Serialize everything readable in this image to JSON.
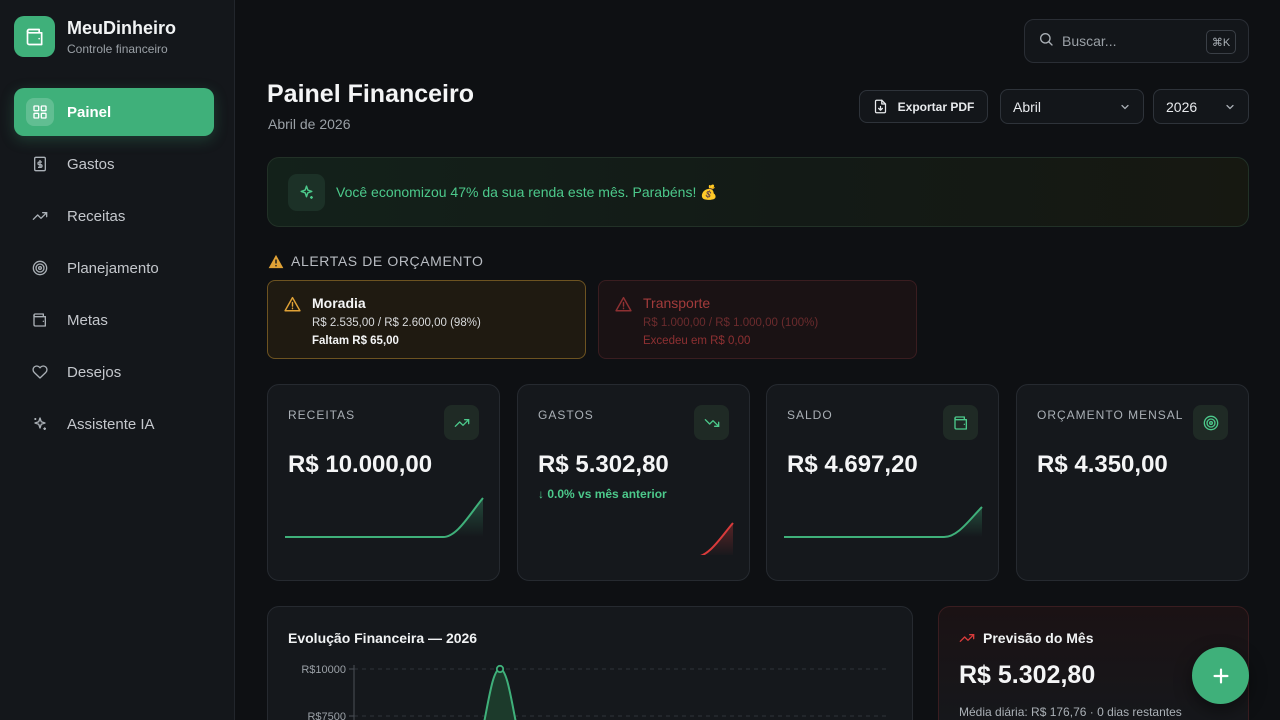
{
  "brand": {
    "name": "MeuDinheiro",
    "subtitle": "Controle financeiro"
  },
  "sidebar": {
    "items": [
      {
        "label": "Painel",
        "icon": "dashboard-icon",
        "active": true
      },
      {
        "label": "Gastos",
        "icon": "receipt-icon"
      },
      {
        "label": "Receitas",
        "icon": "trending-up-icon"
      },
      {
        "label": "Planejamento",
        "icon": "target-icon"
      },
      {
        "label": "Metas",
        "icon": "wallet-icon"
      },
      {
        "label": "Desejos",
        "icon": "heart-icon"
      },
      {
        "label": "Assistente IA",
        "icon": "sparkles-icon"
      }
    ]
  },
  "search": {
    "placeholder": "Buscar...",
    "shortcut": "⌘K"
  },
  "header": {
    "title": "Painel Financeiro",
    "subtitle": "Abril de 2026",
    "export_label": "Exportar PDF",
    "month": "Abril",
    "year": "2026"
  },
  "banner": {
    "text": "Você economizou 47% da sua renda este mês. Parabéns! 💰"
  },
  "alerts": {
    "title": "ALERTAS DE ORÇAMENTO",
    "items": [
      {
        "name": "Moradia",
        "detail": "R$ 2.535,00 / R$ 2.600,00 (98%)",
        "note": "Faltam R$ 65,00",
        "progress": 0.98
      },
      {
        "name": "Transporte",
        "detail": "R$ 1.000,00 / R$ 1.000,00 (100%)",
        "note": "Excedeu em R$ 0,00",
        "progress": 1.0
      }
    ]
  },
  "stats": [
    {
      "label": "RECEITAS",
      "value": "R$ 10.000,00",
      "icon": "trending-up-icon"
    },
    {
      "label": "GASTOS",
      "value": "R$ 5.302,80",
      "change": "↓ 0.0% vs mês anterior",
      "icon": "trending-down-icon"
    },
    {
      "label": "SALDO",
      "value": "R$ 4.697,20",
      "icon": "wallet-icon"
    },
    {
      "label": "ORÇAMENTO MENSAL",
      "value": "R$ 4.350,00",
      "icon": "target-icon"
    }
  ],
  "colors": {
    "accent": "#3fb07a",
    "positive": "#4cc98b",
    "negative": "#d93b3b",
    "warning": "#e0a236"
  },
  "evolution": {
    "title": "Evolução Financeira — 2026",
    "y_ticks": [
      "R$10000",
      "R$7500"
    ]
  },
  "forecast": {
    "title": "Previsão do Mês",
    "value": "R$ 5.302,80",
    "note": "Média diária: R$ 176,76 · 0 dias restantes"
  },
  "fab": {
    "icon": "plus-icon"
  }
}
